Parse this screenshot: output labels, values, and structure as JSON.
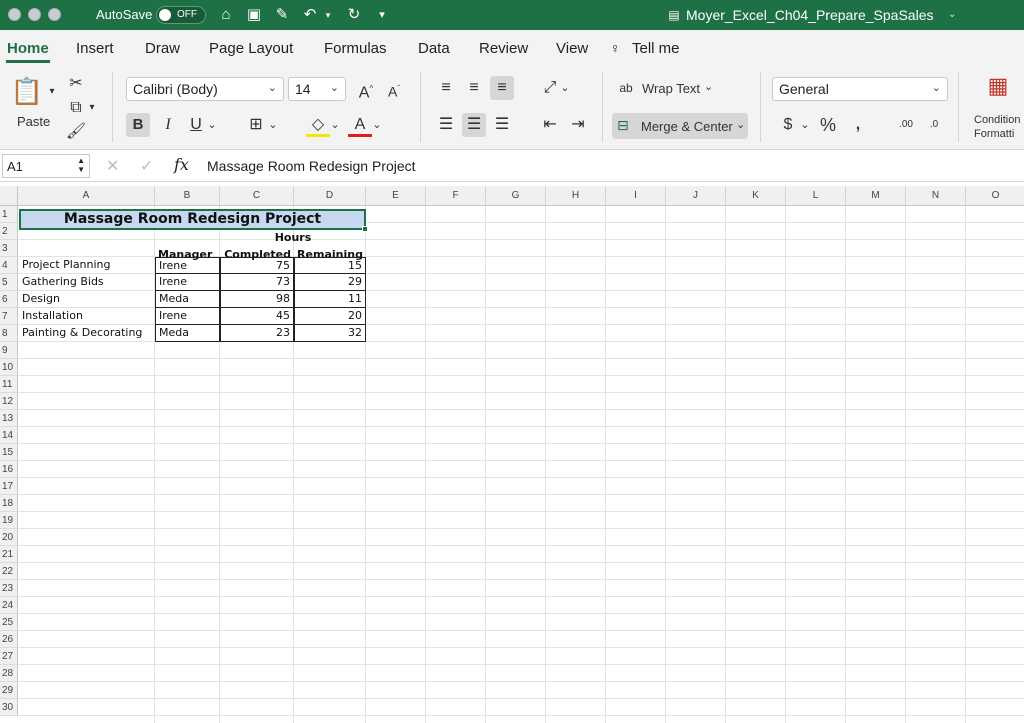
{
  "titlebar": {
    "autosave_label": "AutoSave",
    "autosave_state": "OFF",
    "doc_title": "Moyer_Excel_Ch04_Prepare_SpaSales"
  },
  "tabs": [
    "Home",
    "Insert",
    "Draw",
    "Page Layout",
    "Formulas",
    "Data",
    "Review",
    "View",
    "Tell me"
  ],
  "ribbon": {
    "paste_label": "Paste",
    "font_name": "Calibri (Body)",
    "font_size": "14",
    "wrap_text": "Wrap Text",
    "merge_center": "Merge & Center",
    "number_format": "General",
    "conditional_line1": "Condition",
    "conditional_line2": "Formatti"
  },
  "formula_bar": {
    "name_box": "A1",
    "fx": "fx",
    "formula": "Massage Room Redesign Project"
  },
  "columns": [
    "A",
    "B",
    "C",
    "D",
    "E",
    "F",
    "G",
    "H",
    "I",
    "J",
    "K",
    "L",
    "M",
    "N",
    "O"
  ],
  "rows": [
    "1",
    "2",
    "3",
    "4",
    "5",
    "6",
    "7",
    "8",
    "9",
    "10",
    "11",
    "12",
    "13",
    "14",
    "15",
    "16",
    "17",
    "18",
    "19",
    "20",
    "21",
    "22",
    "23",
    "24",
    "25",
    "26",
    "27",
    "28",
    "29",
    "30"
  ],
  "sheet": {
    "title": "Massage Room Redesign Project",
    "hours_label": "Hours",
    "headers": {
      "manager": "Manager",
      "completed": "Completed",
      "remaining": "Remaining"
    },
    "tasks": [
      {
        "name": "Project Planning",
        "manager": "Irene",
        "completed": "75",
        "remaining": "15"
      },
      {
        "name": "Gathering Bids",
        "manager": "Irene",
        "completed": "73",
        "remaining": "29"
      },
      {
        "name": "Design",
        "manager": "Meda",
        "completed": "98",
        "remaining": "11"
      },
      {
        "name": "Installation",
        "manager": "Irene",
        "completed": "45",
        "remaining": "20"
      },
      {
        "name": "Painting & Decorating",
        "manager": "Meda",
        "completed": "23",
        "remaining": "32"
      }
    ]
  }
}
